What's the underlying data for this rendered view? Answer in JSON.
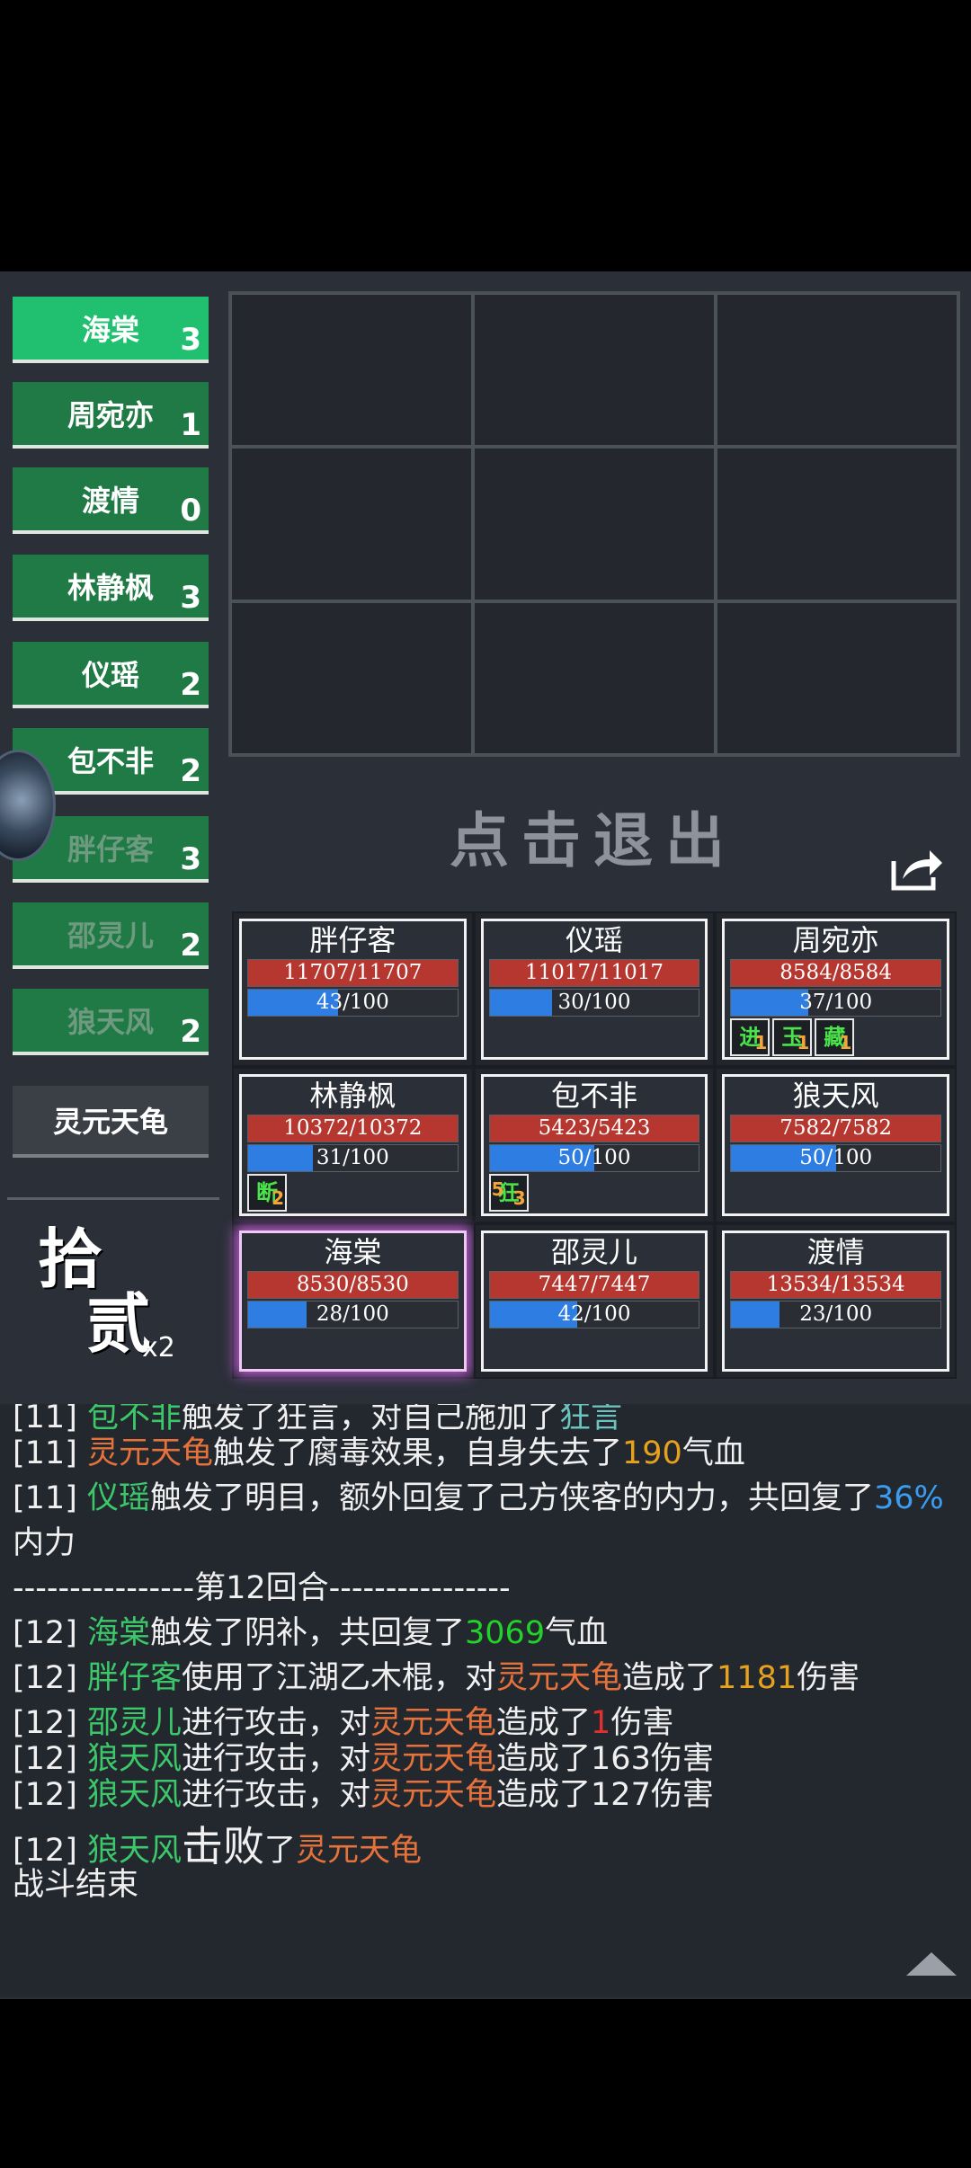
{
  "turn_order": [
    {
      "name": "海棠",
      "count": "3",
      "state": "active"
    },
    {
      "name": "周宛亦",
      "count": "1",
      "state": "normal"
    },
    {
      "name": "渡情",
      "count": "0",
      "state": "normal"
    },
    {
      "name": "林静枫",
      "count": "3",
      "state": "normal"
    },
    {
      "name": "仪瑶",
      "count": "2",
      "state": "normal"
    },
    {
      "name": "包不非",
      "count": "2",
      "state": "normal"
    },
    {
      "name": "胖仔客",
      "count": "3",
      "state": "faded"
    },
    {
      "name": "邵灵儿",
      "count": "2",
      "state": "faded"
    },
    {
      "name": "狼天风",
      "count": "2",
      "state": "faded"
    },
    {
      "name": "灵元天龟",
      "count": "",
      "state": "enemy"
    }
  ],
  "exit_label": "点击退出",
  "round_badge": {
    "tens": "拾",
    "ones": "贰",
    "speed": "x2"
  },
  "cards": [
    {
      "name": "胖仔客",
      "hp": "11707/11707",
      "hp_pct": 100,
      "mp": "43/100",
      "mp_pct": 43,
      "buffs": [],
      "selected": false
    },
    {
      "name": "仪瑶",
      "hp": "11017/11017",
      "hp_pct": 100,
      "mp": "30/100",
      "mp_pct": 30,
      "buffs": [],
      "selected": false
    },
    {
      "name": "周宛亦",
      "hp": "8584/8584",
      "hp_pct": 100,
      "mp": "37/100",
      "mp_pct": 37,
      "buffs": [
        {
          "icon": "进",
          "num": "1"
        },
        {
          "icon": "玉",
          "num": "1"
        },
        {
          "icon": "藏",
          "num": "1"
        }
      ],
      "selected": false
    },
    {
      "name": "林静枫",
      "hp": "10372/10372",
      "hp_pct": 100,
      "mp": "31/100",
      "mp_pct": 31,
      "buffs": [
        {
          "icon": "断",
          "num": "2"
        }
      ],
      "selected": false
    },
    {
      "name": "包不非",
      "hp": "5423/5423",
      "hp_pct": 100,
      "mp": "50/100",
      "mp_pct": 50,
      "buffs": [
        {
          "icon": "狂",
          "num": "3",
          "lead": "5"
        }
      ],
      "selected": false
    },
    {
      "name": "狼天风",
      "hp": "7582/7582",
      "hp_pct": 100,
      "mp": "50/100",
      "mp_pct": 50,
      "buffs": [],
      "selected": false
    },
    {
      "name": "海棠",
      "hp": "8530/8530",
      "hp_pct": 100,
      "mp": "28/100",
      "mp_pct": 28,
      "buffs": [],
      "selected": true
    },
    {
      "name": "邵灵儿",
      "hp": "7447/7447",
      "hp_pct": 100,
      "mp": "42/100",
      "mp_pct": 42,
      "buffs": [],
      "selected": false
    },
    {
      "name": "渡情",
      "hp": "13534/13534",
      "hp_pct": 100,
      "mp": "23/100",
      "mp_pct": 23,
      "buffs": [],
      "selected": false
    }
  ],
  "log": [
    [
      [
        "[11] ",
        ""
      ],
      [
        "包不非",
        "g"
      ],
      [
        "触发了狂言，对自己施加了",
        ""
      ],
      [
        "狂言",
        "c"
      ]
    ],
    [
      [
        "[11] ",
        ""
      ],
      [
        "灵元天龟",
        "o"
      ],
      [
        "触发了腐毒效果，自身失去了",
        ""
      ],
      [
        "190",
        "y"
      ],
      [
        "气血",
        ""
      ]
    ],
    [
      [
        "[11] ",
        ""
      ],
      [
        "仪瑶",
        "g"
      ],
      [
        "触发了明目，额外回复了己方侠客的内力，共回复了",
        ""
      ],
      [
        "36%",
        "b"
      ]
    ],
    [
      [
        "内力",
        ""
      ]
    ],
    [
      [
        "----------------第12回合----------------",
        ""
      ]
    ],
    [
      [
        "[12] ",
        ""
      ],
      [
        "海棠",
        "g"
      ],
      [
        "触发了阴补，共回复了",
        ""
      ],
      [
        "3069",
        "lg"
      ],
      [
        "气血",
        ""
      ]
    ],
    [
      [
        "[12] ",
        ""
      ],
      [
        "胖仔客",
        "g"
      ],
      [
        "使用了江湖乙木棍，对",
        ""
      ],
      [
        "灵元天龟",
        "o"
      ],
      [
        "造成了",
        ""
      ],
      [
        "1181",
        "y"
      ],
      [
        "伤害",
        ""
      ]
    ],
    [
      [
        "[12] ",
        ""
      ],
      [
        "邵灵儿",
        "g"
      ],
      [
        "进行攻击，对",
        ""
      ],
      [
        "灵元天龟",
        "o"
      ],
      [
        "造成了",
        ""
      ],
      [
        "1",
        "r"
      ],
      [
        "伤害",
        ""
      ]
    ],
    [
      [
        "[12] ",
        ""
      ],
      [
        "狼天风",
        "g"
      ],
      [
        "进行攻击，对",
        ""
      ],
      [
        "灵元天龟",
        "o"
      ],
      [
        "造成了163伤害",
        ""
      ]
    ],
    [
      [
        "[12] ",
        ""
      ],
      [
        "狼天风",
        "g"
      ],
      [
        "进行攻击，对",
        ""
      ],
      [
        "灵元天龟",
        "o"
      ],
      [
        "造成了127伤害",
        ""
      ]
    ],
    [
      [
        "[12] ",
        ""
      ],
      [
        "狼天风",
        "g"
      ],
      [
        "击败",
        "big"
      ],
      [
        "了",
        ""
      ],
      [
        "灵元天龟",
        "o"
      ]
    ],
    [
      [
        "战斗结束",
        ""
      ]
    ]
  ],
  "colors": {
    "accent_active": "#21c070",
    "list_green": "#1f7a45",
    "hp_red": "#b5372f",
    "mp_blue": "#2d7de2",
    "name_green": "#3cc86a",
    "enemy_orange": "#e5723b"
  }
}
